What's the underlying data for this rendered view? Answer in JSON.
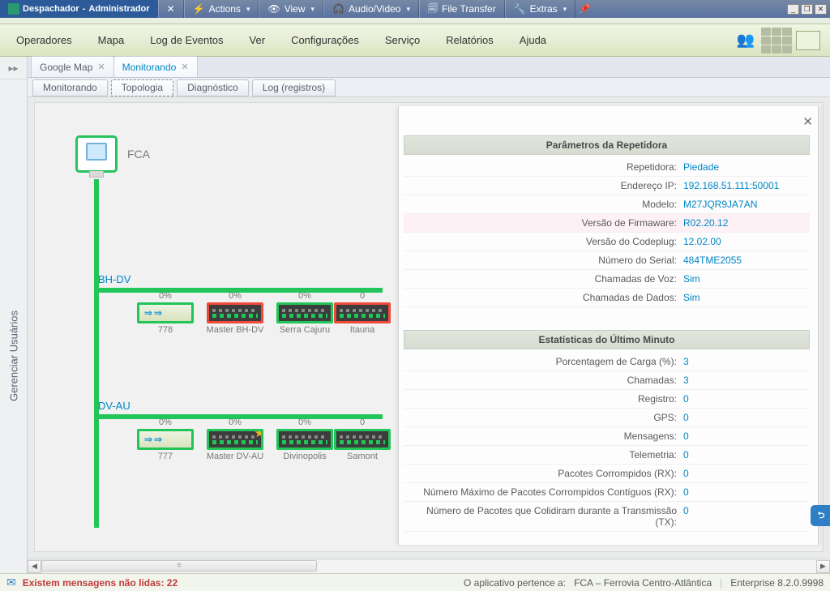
{
  "remote": {
    "title_prefix": "Despachador",
    "title_suffix": "Administrador",
    "actions": "Actions",
    "view": "View",
    "audio_video": "Audio/Video",
    "file_transfer": "File Transfer",
    "extras": "Extras"
  },
  "menu": {
    "operadores": "Operadores",
    "mapa": "Mapa",
    "log_eventos": "Log de Eventos",
    "ver": "Ver",
    "config": "Configurações",
    "servico": "Serviço",
    "relatorios": "Relatórios",
    "ajuda": "Ajuda"
  },
  "left_rail": {
    "label": "Gerenciar Usuários",
    "collapse_glyph": "▸▸"
  },
  "upper_tabs": {
    "google_map": "Google Map",
    "monitorando": "Monitorando"
  },
  "sub_tabs": {
    "monitorando": "Monitorando",
    "topologia": "Topologia",
    "diagnostico": "Diagnóstico",
    "log": "Log (registros)"
  },
  "topology": {
    "root_label": "FCA",
    "branch1": "BH-DV",
    "branch2": "DV-AU",
    "pct": "0%",
    "row1": [
      {
        "type": "switch",
        "id": "778",
        "pct": "0%"
      },
      {
        "type": "rep",
        "id": "Master BH-DV",
        "pct": "0%",
        "red": true,
        "star": false
      },
      {
        "type": "rep",
        "id": "Serra Cajuru",
        "pct": "0%"
      },
      {
        "type": "rep",
        "id": "Itauna",
        "pct": "0",
        "red": true,
        "cut": true
      }
    ],
    "row2": [
      {
        "type": "switch",
        "id": "777",
        "pct": "0%"
      },
      {
        "type": "rep",
        "id": "Master DV-AU",
        "pct": "0%",
        "star": true
      },
      {
        "type": "rep",
        "id": "Divinopolis",
        "pct": "0%"
      },
      {
        "type": "rep",
        "id": "Samont",
        "pct": "0",
        "cut": true
      }
    ]
  },
  "panel": {
    "head1": "Parâmetros da Repetidora",
    "head2": "Estatísticas do Último Minuto",
    "fields1": [
      {
        "k": "Repetidora:",
        "v": "Piedade"
      },
      {
        "k": "Endereço IP:",
        "v": "192.168.51.111:50001"
      },
      {
        "k": "Modelo:",
        "v": "M27JQR9JA7AN"
      },
      {
        "k": "Versão de Firmaware:",
        "v": "R02.20.12",
        "hl": true
      },
      {
        "k": "Versão do Codeplug:",
        "v": "12.02.00"
      },
      {
        "k": "Número do Serial:",
        "v": "484TME2055"
      },
      {
        "k": "Chamadas de Voz:",
        "v": "Sim"
      },
      {
        "k": "Chamadas de Dados:",
        "v": "Sim"
      }
    ],
    "fields2": [
      {
        "k": "Porcentagem de Carga (%):",
        "v": "3"
      },
      {
        "k": "Chamadas:",
        "v": "3"
      },
      {
        "k": "Registro:",
        "v": "0"
      },
      {
        "k": "GPS:",
        "v": "0"
      },
      {
        "k": "Mensagens:",
        "v": "0"
      },
      {
        "k": "Telemetria:",
        "v": "0"
      },
      {
        "k": "Pacotes Corrompidos (RX):",
        "v": "0"
      },
      {
        "k": "Número Máximo de Pacotes Corrompidos Contíguos (RX):",
        "v": "0"
      },
      {
        "k": "Número de Pacotes que Colidiram durante a Transmissão (TX):",
        "v": "0"
      }
    ]
  },
  "status": {
    "unread": "Existem mensagens não lidas: 22",
    "owner_label": "O aplicativo pertence a:",
    "owner_value": "FCA – Ferrovia Centro-Atlântica",
    "version": "Enterprise 8.2.0.9998"
  }
}
